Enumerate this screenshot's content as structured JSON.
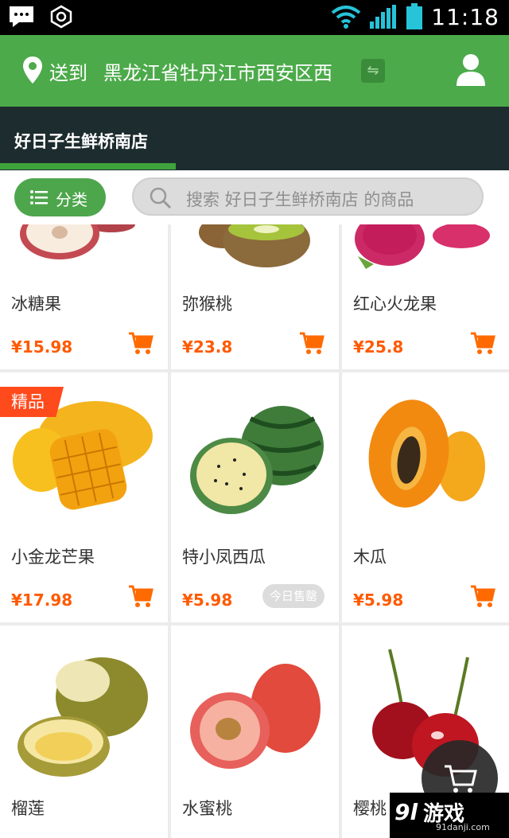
{
  "status_bar": {
    "time": "11:18",
    "icons": [
      "chat-bubble-icon",
      "sync-icon",
      "wifi-icon",
      "signal-icon",
      "battery-icon"
    ]
  },
  "location": {
    "label": "送到",
    "address": "黑龙江省牡丹江市西安区西",
    "icons": [
      "location-pin-icon",
      "switch-icon",
      "user-icon"
    ]
  },
  "store": {
    "name": "好日子生鲜桥南店"
  },
  "search": {
    "category_label": "分类",
    "placeholder": "搜索 好日子生鲜桥南店 的商品"
  },
  "products": [
    {
      "name": "冰糖果",
      "price": "¥15.98"
    },
    {
      "name": "弥猴桃",
      "price": "¥23.8"
    },
    {
      "name": "红心火龙果",
      "price": "¥25.8"
    },
    {
      "name": "小金龙芒果",
      "price": "¥17.98",
      "badge": "精品"
    },
    {
      "name": "特小凤西瓜",
      "price": "¥5.98",
      "status": "今日售罄"
    },
    {
      "name": "木瓜",
      "price": "¥5.98"
    },
    {
      "name": "榴莲",
      "price": ""
    },
    {
      "name": "水蜜桃",
      "price": ""
    },
    {
      "name": "樱桃",
      "price": ""
    }
  ],
  "watermark": {
    "logo": "9l",
    "main": "游戏",
    "sub": "91danji.com"
  },
  "colors": {
    "primary_green": "#4caa4a",
    "store_bar": "#1d2c2e",
    "price_orange": "#ff5a00",
    "badge_red": "#ff4a1c"
  }
}
